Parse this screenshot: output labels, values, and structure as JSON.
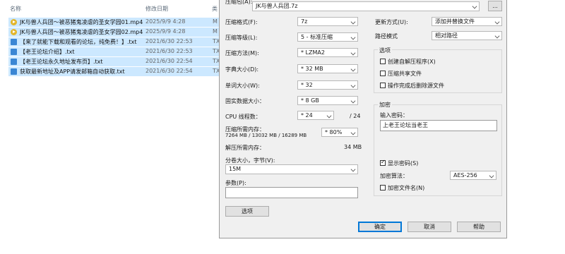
{
  "explorer": {
    "columns": {
      "name": "名称",
      "date": "修改日期",
      "type": "类"
    },
    "files": [
      {
        "name": "JK与兽人兵团～被恶猪鬼凌虐的圣女学园01.mp4",
        "date": "2025/9/9 4:28",
        "type": "M",
        "icon": "video-file-icon"
      },
      {
        "name": "JK与兽人兵团～被恶猪鬼凌虐的圣女学园02.mp4",
        "date": "2025/9/9 4:28",
        "type": "M",
        "icon": "video-file-icon"
      },
      {
        "name": "【来了就能下载和观看的论坛，纯免费！】.txt",
        "date": "2021/6/30 22:53",
        "type": "TX",
        "icon": "text-file-icon"
      },
      {
        "name": "【老王论坛介绍】.txt",
        "date": "2021/6/30 22:53",
        "type": "TX",
        "icon": "text-file-icon"
      },
      {
        "name": "【老王论坛永久地址发布页】.txt",
        "date": "2021/6/30 22:54",
        "type": "TX",
        "icon": "text-file-icon"
      },
      {
        "name": "获取最新地址及APP请发邮箱自动获取.txt",
        "date": "2021/6/30 22:54",
        "type": "TX",
        "icon": "text-file-icon"
      }
    ]
  },
  "dialog": {
    "archive": {
      "label": "压缩包(A):",
      "value": "JK与兽人兵团.7z",
      "browse": "..."
    },
    "left": {
      "format": {
        "label": "压缩格式(F):",
        "value": "7z"
      },
      "level": {
        "label": "压缩等级(L):",
        "value": "5 - 标准压缩"
      },
      "method": {
        "label": "压缩方法(M):",
        "value": "* LZMA2"
      },
      "dict": {
        "label": "字典大小(D):",
        "value": "* 32 MB"
      },
      "word": {
        "label": "单词大小(W):",
        "value": "* 32"
      },
      "solid": {
        "label": "固实数据大小：",
        "value": "* 8 GB"
      },
      "cpu": {
        "label": "CPU 线程数：",
        "value": "* 24",
        "max": "/ 24"
      },
      "mem": {
        "label": "压缩所需内存：",
        "detail": "7264 MB / 13032 MB / 16289 MB",
        "value": "* 80%"
      },
      "decomp": {
        "label": "解压所需内存：",
        "value": "34 MB"
      },
      "split": {
        "label": "分卷大小，字节(V):",
        "value": "15M"
      },
      "params": {
        "label": "参数(P):",
        "value": ""
      },
      "options_button": "选项"
    },
    "right": {
      "update": {
        "label": "更新方式(U):",
        "value": "添加并替换文件"
      },
      "path": {
        "label": "路径模式",
        "value": "相对路径"
      },
      "options": {
        "title": "选项",
        "items": [
          {
            "label": "创建自解压程序(X)",
            "checked": false
          },
          {
            "label": "压缩共享文件",
            "checked": false
          },
          {
            "label": "操作完成后删除源文件",
            "checked": false
          }
        ]
      },
      "encryption": {
        "title": "加密",
        "password_label": "输入密码：",
        "password_value": "上老王论坛当老王",
        "show_password": {
          "label": "显示密码(S)",
          "checked": true
        },
        "method_label": "加密算法：",
        "method_value": "AES-256",
        "encrypt_names": {
          "label": "加密文件名(N)",
          "checked": false
        }
      }
    },
    "buttons": {
      "ok": "确定",
      "cancel": "取消",
      "help": "帮助"
    }
  }
}
